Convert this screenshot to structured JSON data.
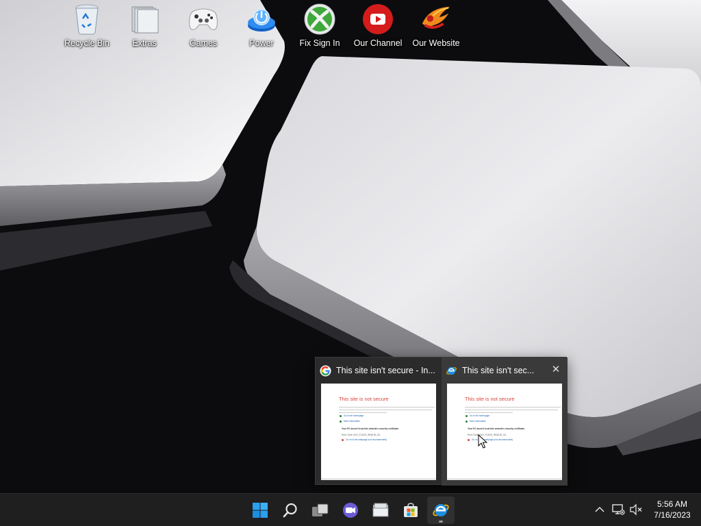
{
  "desktop": {
    "icons": [
      {
        "label": "Recycle Bin",
        "icon": "recycle-bin-icon"
      },
      {
        "label": "Extras",
        "icon": "folders-icon"
      },
      {
        "label": "Games",
        "icon": "game-controller-icon"
      },
      {
        "label": "Power",
        "icon": "power-icon"
      },
      {
        "label": "Fix Sign In",
        "icon": "xbox-icon"
      },
      {
        "label": "Our Channel",
        "icon": "youtube-icon"
      },
      {
        "label": "Our Website",
        "icon": "website-logo-icon"
      }
    ]
  },
  "thumbnail_preview": {
    "items": [
      {
        "title": "This site isn't secure - In...",
        "icon": "google-icon",
        "page": {
          "heading": "This site is not secure",
          "warning": "Your PC doesn't trust this website's security certificate.",
          "error_code": "Error Code: DLG_FLAGS_INVALID_CA",
          "option1": "Go to the homepage",
          "option2": "More information",
          "option3": "Go on to the webpage (not recommended)"
        }
      },
      {
        "title": "This site isn't sec...",
        "icon": "internet-explorer-icon",
        "close": "✕",
        "page": {
          "heading": "This site is not secure",
          "warning": "Your PC doesn't trust this website's security certificate.",
          "error_code": "Error Code: DLG_FLAGS_INVALID_CA",
          "option1": "Go to the homepage",
          "option2": "More information",
          "option3": "Go on to the webpage (not recommended)"
        }
      }
    ]
  },
  "taskbar": {
    "apps": [
      {
        "name": "Start",
        "icon": "windows-start-icon"
      },
      {
        "name": "Search",
        "icon": "search-icon"
      },
      {
        "name": "Task View",
        "icon": "task-view-icon"
      },
      {
        "name": "Chat",
        "icon": "chat-icon"
      },
      {
        "name": "File Explorer",
        "icon": "file-explorer-icon"
      },
      {
        "name": "Microsoft Store",
        "icon": "store-icon"
      },
      {
        "name": "Internet Explorer",
        "icon": "internet-explorer-icon"
      }
    ],
    "tray": {
      "overflow_icon": "chevron-up-icon",
      "network_icon": "network-disconnected-icon",
      "volume_icon": "volume-muted-icon"
    },
    "clock": {
      "time": "5:56 AM",
      "date": "7/16/2023"
    }
  },
  "colors": {
    "taskbar": "#1f1f1f",
    "thumbnail_bg": "#2b2b2b",
    "error_red": "#d9423a",
    "windows_blue": "#0a84d8"
  }
}
